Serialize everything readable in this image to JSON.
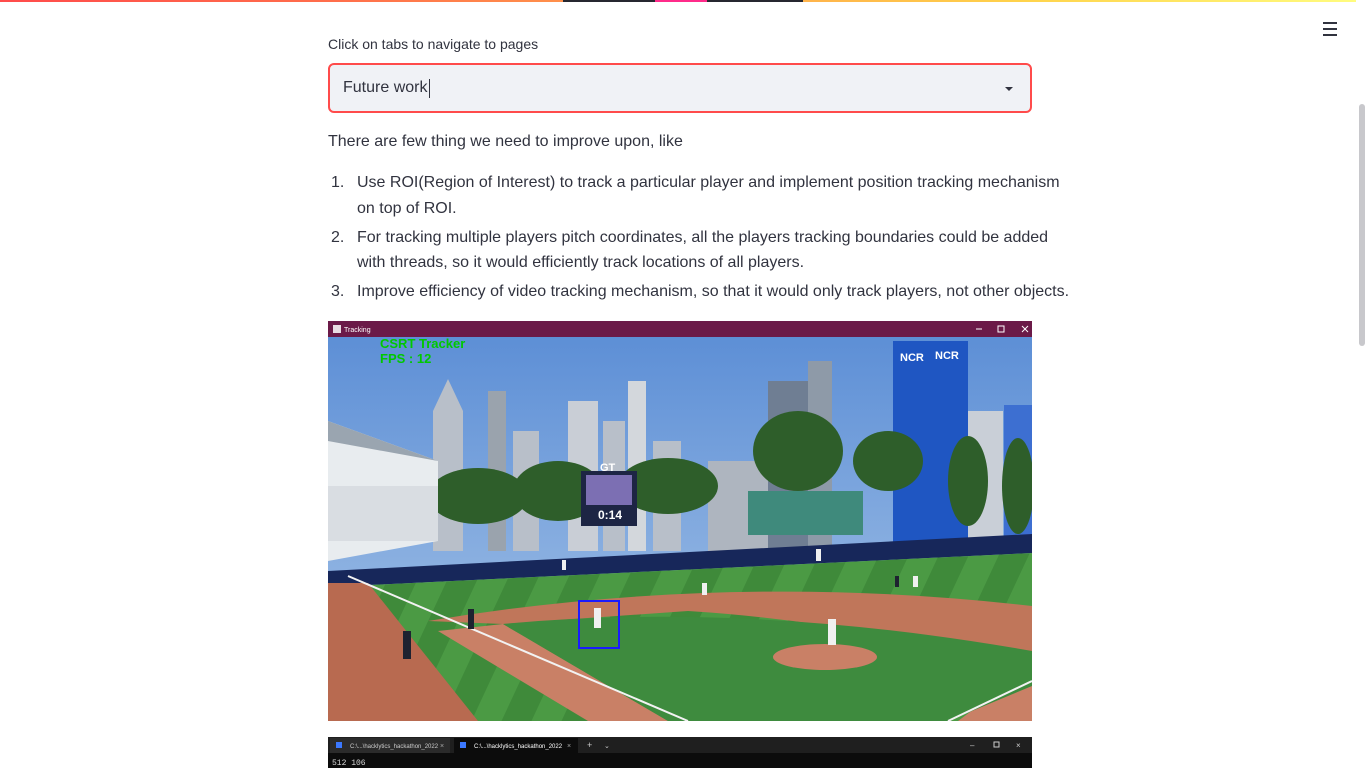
{
  "nav": {
    "select_label": "Click on tabs to navigate to pages",
    "selected_page": "Future work",
    "menu_icon": "hamburger-menu-icon"
  },
  "content": {
    "intro": "There are few thing we need to improve upon, like",
    "items": [
      {
        "number": "1.",
        "line1": "Use ROI(Region of Interest) to track a particular player and implement position tracking mechanism",
        "line2": "on top of ROI."
      },
      {
        "number": "2.",
        "line1": "For tracking multiple players pitch coordinates, all the players tracking boundaries could be added",
        "line2": "with threads, so it would efficiently track locations of all players."
      },
      {
        "number": "3.",
        "line1": "Improve efficiency of video tracking mechanism, so that it would only track players, not other objects."
      }
    ]
  },
  "tracking_window": {
    "title": "Tracking",
    "tracker_label": "CSRT Tracker",
    "fps_label": "FPS : 12",
    "scoreboard_time": "0:14",
    "scoreboard_logo": "GT",
    "building_sign_1": "NCR",
    "building_sign_2": "NCR"
  },
  "terminal_window": {
    "tab1": "C:\\...\\hacklytics_hackathon_2022",
    "tab2": "C:\\...\\hacklytics_hackathon_2022",
    "output": "512 106"
  },
  "colors": {
    "accent": "#ff4b4b",
    "text": "#31333f",
    "select_bg": "#f0f2f6",
    "window_titlebar": "#6b1a48",
    "tracker_text": "#00c800",
    "bbox": "#1a1aff"
  }
}
